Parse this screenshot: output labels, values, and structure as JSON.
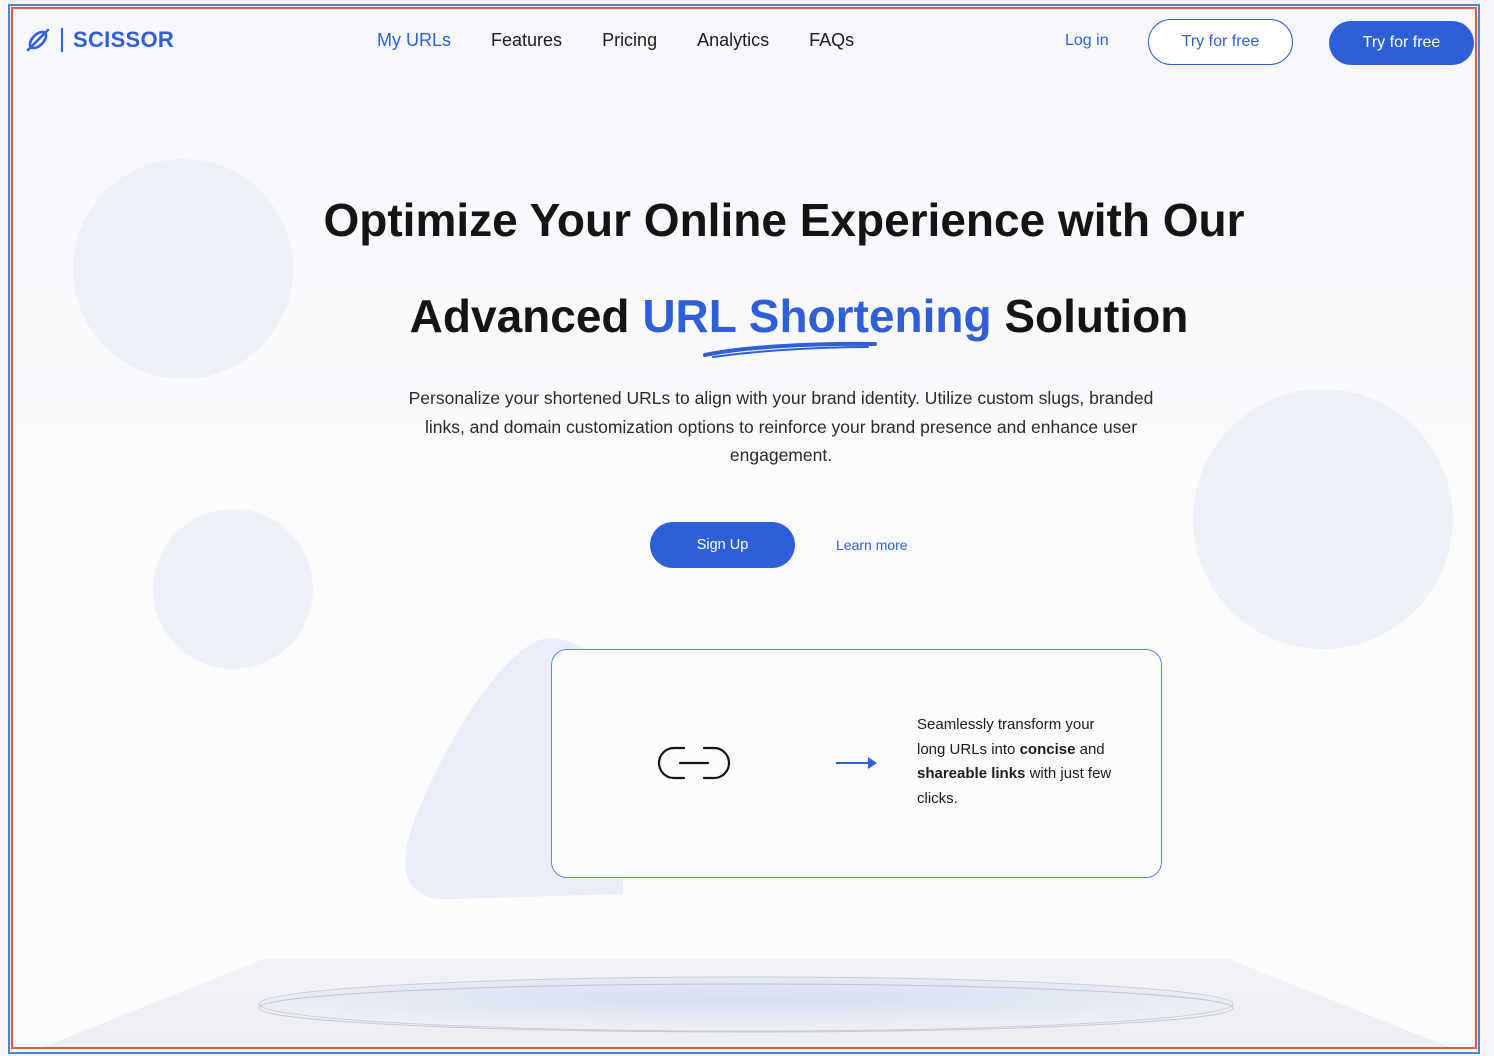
{
  "brand": {
    "name": "SCISSOR",
    "icon": "scissor-link-icon",
    "color": "#2f5fd6"
  },
  "nav": {
    "links": [
      {
        "label": "My URLs",
        "active": true
      },
      {
        "label": "Features",
        "active": false
      },
      {
        "label": "Pricing",
        "active": false
      },
      {
        "label": "Analytics",
        "active": false
      },
      {
        "label": "FAQs",
        "active": false
      }
    ],
    "login_label": "Log in",
    "try_outline_label": "Try for free",
    "try_filled_label": "Try for free"
  },
  "hero": {
    "line1": "Optimize Your Online Experience with Our",
    "line2_prefix": "Advanced ",
    "line2_highlight": "URL Shortening",
    "line2_suffix": " Solution",
    "description": "Personalize your shortened URLs to align with your brand identity. Utilize custom slugs, branded links, and domain customization options to reinforce your brand presence and enhance user engagement.",
    "signup_label": "Sign Up",
    "learn_more_label": "Learn more"
  },
  "card": {
    "link_icon": "link-icon",
    "arrow_icon": "arrow-right-icon",
    "text_part1": "Seamlessly transform your long URLs into ",
    "text_bold1": "concise",
    "text_part2": " and ",
    "text_bold2": "shareable links",
    "text_part3": " with just few clicks."
  },
  "colors": {
    "accent": "#2f5fd6",
    "text": "#141414"
  }
}
